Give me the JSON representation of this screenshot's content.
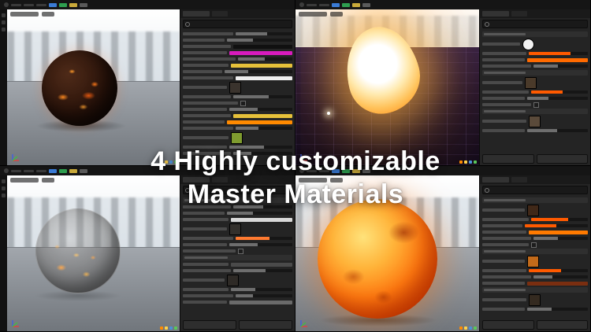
{
  "overlay": {
    "line1": "4 Highly customizable",
    "line2": "Master Materials"
  },
  "colors": {
    "accent_orange": "#ff5a00",
    "magenta": "#d81bbd",
    "yellow": "#e6c13a",
    "panel_bg": "#242424"
  },
  "icons": {
    "search": "magnifier-icon",
    "axis_gizmo": "axis-gizmo-icon",
    "editor_logo": "editor-logo-icon"
  },
  "topbar": {
    "chips": [
      {
        "c": "#3a7bd5"
      },
      {
        "c": "#2e9e4f"
      },
      {
        "c": "#c9a93a"
      },
      {
        "c": "#5a5a5a"
      }
    ]
  },
  "vp_icons": [
    "#ff8a00",
    "#ffd24a",
    "#4a90d9",
    "#5ac85a"
  ],
  "panels": {
    "tl": {
      "rows": [
        {
          "w": "slider",
          "lw": 46,
          "pct": 55
        },
        {
          "w": "slider",
          "lw": 38,
          "pct": 40
        },
        {
          "w": "color",
          "lw": 44,
          "c": "#101010"
        },
        {
          "w": "color",
          "lw": 40,
          "c": "#d81bbd"
        },
        {
          "w": "slider",
          "lw": 48,
          "pct": 50
        },
        {
          "w": "color",
          "lw": 42,
          "c": "#e6c13a"
        },
        {
          "w": "slider",
          "lw": 36,
          "pct": 35
        },
        {
          "w": "color",
          "lw": 46,
          "c": "#ededed"
        },
        {
          "w": "thumb",
          "lw": 40,
          "c": "#3a332d"
        },
        {
          "w": "slider",
          "lw": 44,
          "pct": 60
        },
        {
          "w": "check",
          "lw": 50
        },
        {
          "w": "slider",
          "lw": 40,
          "pct": 45
        },
        {
          "w": "color",
          "lw": 44,
          "c": "#e6c13a"
        },
        {
          "w": "color",
          "lw": 38,
          "c": "#ff8a00"
        },
        {
          "w": "slider",
          "lw": 46,
          "pct": 40
        },
        {
          "w": "thumb",
          "lw": 42,
          "c": "#7f9c2f"
        },
        {
          "w": "slider",
          "lw": 40,
          "pct": 55
        },
        {
          "w": "slider",
          "lw": 44,
          "pct": 30
        }
      ]
    },
    "tr": {
      "rows": [
        {
          "w": "section"
        },
        {
          "w": "circle",
          "lw": 36,
          "c": "#f2f2f2"
        },
        {
          "w": "slider",
          "lw": 42,
          "pct": 70,
          "c": "#ff5a00"
        },
        {
          "w": "color",
          "lw": 40,
          "c": "#ff6a00"
        },
        {
          "w": "slider",
          "lw": 46,
          "pct": 45
        },
        {
          "w": "section"
        },
        {
          "w": "thumb",
          "lw": 38,
          "c": "#4a3a2a"
        },
        {
          "w": "slider",
          "lw": 44,
          "pct": 55,
          "c": "#ff5a00"
        },
        {
          "w": "slider",
          "lw": 40,
          "pct": 35
        },
        {
          "w": "check",
          "lw": 46
        },
        {
          "w": "section"
        },
        {
          "w": "thumb",
          "lw": 42,
          "c": "#5a4a3a"
        },
        {
          "w": "slider",
          "lw": 40,
          "pct": 50
        }
      ]
    },
    "bl": {
      "rows": [
        {
          "w": "section"
        },
        {
          "w": "slider",
          "lw": 44,
          "pct": 50
        },
        {
          "w": "slider",
          "lw": 38,
          "pct": 40
        },
        {
          "w": "color",
          "lw": 42,
          "c": "#d8d8d8"
        },
        {
          "w": "thumb",
          "lw": 40,
          "c": "#33302c"
        },
        {
          "w": "slider",
          "lw": 46,
          "pct": 60,
          "c": "#ff7a30"
        },
        {
          "w": "slider",
          "lw": 40,
          "pct": 45
        },
        {
          "w": "check",
          "lw": 48
        },
        {
          "w": "section"
        },
        {
          "w": "color",
          "lw": 42,
          "c": "#4a4a4a"
        },
        {
          "w": "slider",
          "lw": 44,
          "pct": 55
        },
        {
          "w": "thumb",
          "lw": 38,
          "c": "#2e2a26"
        },
        {
          "w": "slider",
          "lw": 42,
          "pct": 40
        },
        {
          "w": "slider",
          "lw": 46,
          "pct": 30
        },
        {
          "w": "color",
          "lw": 40,
          "c": "#6a6a6a"
        }
      ]
    },
    "br": {
      "rows": [
        {
          "w": "section"
        },
        {
          "w": "thumb",
          "lw": 40,
          "c": "#402818"
        },
        {
          "w": "slider",
          "lw": 44,
          "pct": 65,
          "c": "#ff5a00"
        },
        {
          "w": "slider",
          "lw": 38,
          "pct": 50,
          "c": "#ff5a00"
        },
        {
          "w": "color",
          "lw": 42,
          "c": "#ff7a00"
        },
        {
          "w": "slider",
          "lw": 46,
          "pct": 45
        },
        {
          "w": "check",
          "lw": 44
        },
        {
          "w": "section"
        },
        {
          "w": "thumb",
          "lw": 40,
          "c": "#c26a1a"
        },
        {
          "w": "slider",
          "lw": 42,
          "pct": 55,
          "c": "#ff5a00"
        },
        {
          "w": "slider",
          "lw": 46,
          "pct": 35
        },
        {
          "w": "color",
          "lw": 40,
          "c": "#7a2e10"
        },
        {
          "w": "section"
        },
        {
          "w": "thumb",
          "lw": 42,
          "c": "#342a20"
        },
        {
          "w": "slider",
          "lw": 40,
          "pct": 40
        }
      ]
    }
  }
}
